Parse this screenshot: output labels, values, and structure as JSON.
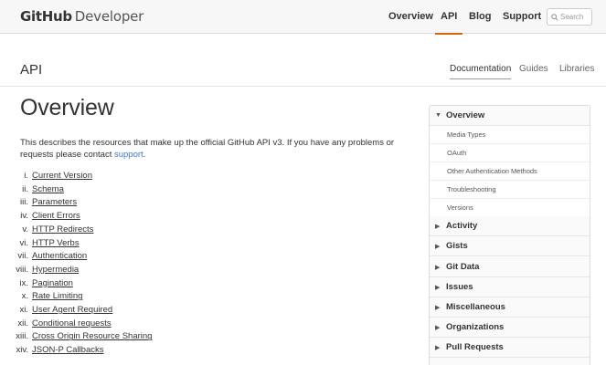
{
  "header": {
    "logo_bold": "GitHub",
    "logo_light": "Developer",
    "nav": [
      {
        "label": "Overview",
        "active": false
      },
      {
        "label": "API",
        "active": true
      },
      {
        "label": "Blog",
        "active": false
      },
      {
        "label": "Support",
        "active": false
      }
    ],
    "search_placeholder": "Search",
    "accent_color": "#d26911"
  },
  "subheader": {
    "title": "API",
    "tabs": [
      {
        "label": "Documentation",
        "active": true
      },
      {
        "label": "Guides",
        "active": false
      },
      {
        "label": "Libraries",
        "active": false
      }
    ]
  },
  "main": {
    "title": "Overview",
    "intro_text": "This describes the resources that make up the official GitHub API v3. If you have any problems or requests please contact ",
    "intro_link": "support",
    "intro_end": ".",
    "link_color": "#4078c0",
    "toc": [
      {
        "num": "i.",
        "label": "Current Version"
      },
      {
        "num": "ii.",
        "label": "Schema"
      },
      {
        "num": "iii.",
        "label": "Parameters"
      },
      {
        "num": "iv.",
        "label": "Client Errors"
      },
      {
        "num": "v.",
        "label": "HTTP Redirects"
      },
      {
        "num": "vi.",
        "label": "HTTP Verbs"
      },
      {
        "num": "vii.",
        "label": "Authentication"
      },
      {
        "num": "viii.",
        "label": "Hypermedia"
      },
      {
        "num": "ix.",
        "label": "Pagination"
      },
      {
        "num": "x.",
        "label": "Rate Limiting"
      },
      {
        "num": "xi.",
        "label": "User Agent Required"
      },
      {
        "num": "xii.",
        "label": "Conditional requests"
      },
      {
        "num": "xiii.",
        "label": "Cross Origin Resource Sharing"
      },
      {
        "num": "xiv.",
        "label": "JSON-P Callbacks"
      }
    ]
  },
  "sidebar": {
    "sections": [
      {
        "label": "Overview",
        "expanded": true,
        "icon": "triangle-down-icon",
        "items": [
          "Media Types",
          "OAuth",
          "Other Authentication Methods",
          "Troubleshooting",
          "Versions"
        ]
      },
      {
        "label": "Activity",
        "expanded": false,
        "icon": "triangle-right-icon"
      },
      {
        "label": "Gists",
        "expanded": false,
        "icon": "triangle-right-icon"
      },
      {
        "label": "Git Data",
        "expanded": false,
        "icon": "triangle-right-icon"
      },
      {
        "label": "Issues",
        "expanded": false,
        "icon": "triangle-right-icon"
      },
      {
        "label": "Miscellaneous",
        "expanded": false,
        "icon": "triangle-right-icon"
      },
      {
        "label": "Organizations",
        "expanded": false,
        "icon": "triangle-right-icon"
      },
      {
        "label": "Pull Requests",
        "expanded": false,
        "icon": "triangle-right-icon"
      }
    ]
  }
}
